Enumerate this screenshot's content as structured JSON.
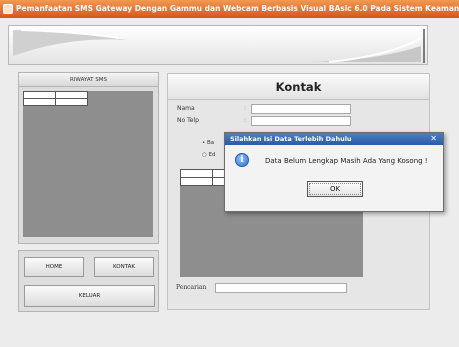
{
  "window": {
    "title": "Pemanfaatan SMS Gateway Dengan Gammu dan Webcam Berbasis Visual BAsic 6.0 Pada Sistem Keamanan R..."
  },
  "left_panel": {
    "header": "RIWAYAT SMS"
  },
  "nav": {
    "home_label": "HOME",
    "kontak_label": "KONTAK",
    "keluar_label": "KELUAR"
  },
  "kontak": {
    "header": "Kontak",
    "nama_label": "Nama",
    "notelp_label": "No Telp",
    "colon": ":",
    "radio1_label": "Ba",
    "radio2_label": "Ed",
    "pencarian_label": "Pencarian"
  },
  "dialog": {
    "title": "Silahkan Isi Data Terlebih Dahulu",
    "close_glyph": "✕",
    "icon": "info-icon",
    "message": "Data Belum Lengkap Masih Ada Yang Kosong !",
    "ok_label": "OK"
  },
  "colors": {
    "titlebar": "#e0642a",
    "dialog_title": "#2a5aa8"
  }
}
